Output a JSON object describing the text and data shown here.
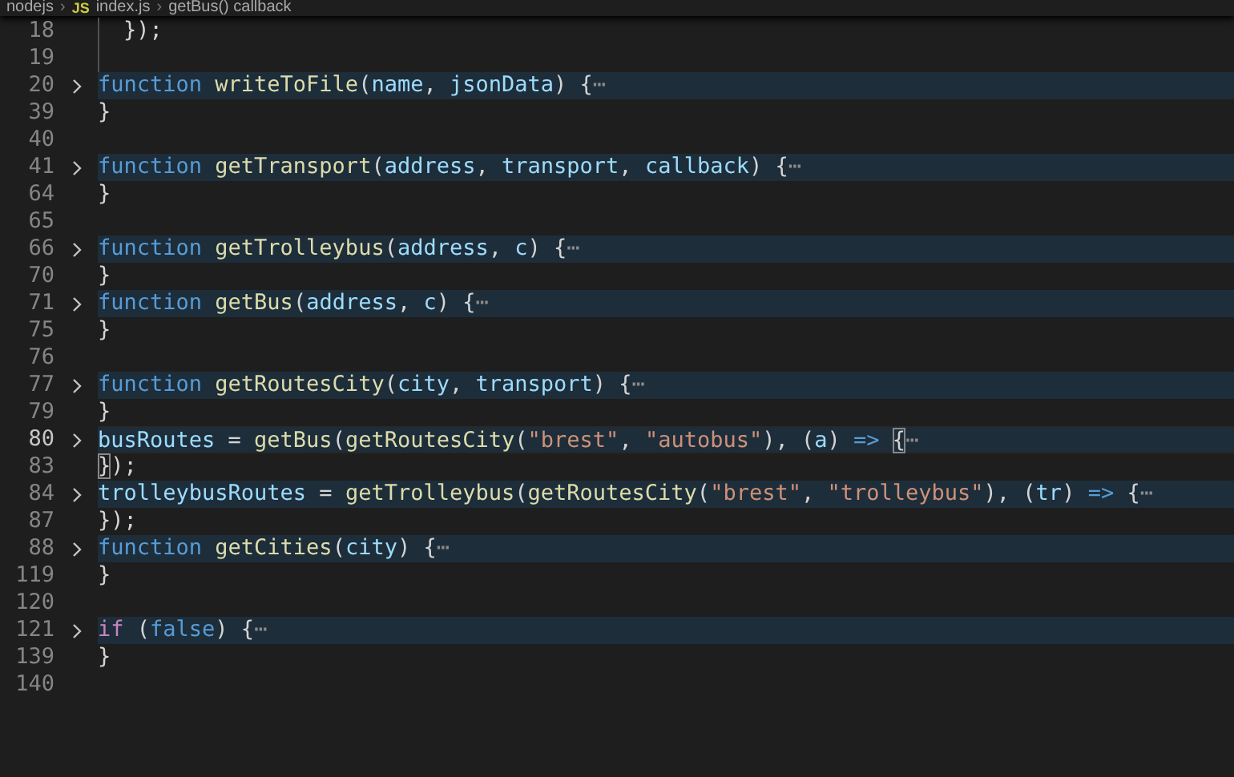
{
  "breadcrumb": [
    {
      "kind": "item",
      "text": "nodejs"
    },
    {
      "kind": "separator",
      "text": "›"
    },
    {
      "kind": "file-type",
      "text": "JS"
    },
    {
      "kind": "item",
      "text": "index.js"
    },
    {
      "kind": "separator",
      "text": "›"
    },
    {
      "kind": "item",
      "text": "getBus() callback"
    }
  ],
  "lines": [
    {
      "number": "18",
      "folded": false,
      "current": false,
      "indent": true,
      "tokens": [
        {
          "kind": "plain",
          "text": "});"
        }
      ]
    },
    {
      "number": "19",
      "current": false,
      "indent": true
    },
    {
      "number": "20",
      "folded": true,
      "current": false,
      "tokens": [
        {
          "kind": "keyword",
          "text": "function"
        },
        {
          "kind": "fn",
          "text": " writeToFile"
        },
        {
          "kind": "plain",
          "text": "("
        },
        {
          "kind": "param",
          "text": "name"
        },
        {
          "kind": "plain",
          "text": ", "
        },
        {
          "kind": "param",
          "text": "jsonData"
        },
        {
          "kind": "plain",
          "text": ") {"
        },
        {
          "kind": "fold",
          "text": "⋯"
        }
      ]
    },
    {
      "number": "39",
      "folded": false,
      "current": false,
      "tokens": [
        {
          "kind": "plain",
          "text": "}"
        }
      ]
    },
    {
      "number": "40",
      "current": false
    },
    {
      "number": "41",
      "folded": true,
      "current": false,
      "tokens": [
        {
          "kind": "keyword",
          "text": "function"
        },
        {
          "kind": "fn",
          "text": " getTransport"
        },
        {
          "kind": "plain",
          "text": "("
        },
        {
          "kind": "param",
          "text": "address"
        },
        {
          "kind": "plain",
          "text": ", "
        },
        {
          "kind": "param",
          "text": "transport"
        },
        {
          "kind": "plain",
          "text": ", "
        },
        {
          "kind": "param",
          "text": "callback"
        },
        {
          "kind": "plain",
          "text": ") {"
        },
        {
          "kind": "fold",
          "text": "⋯"
        }
      ]
    },
    {
      "number": "64",
      "folded": false,
      "current": false,
      "tokens": [
        {
          "kind": "plain",
          "text": "}"
        }
      ]
    },
    {
      "number": "65",
      "current": false
    },
    {
      "number": "66",
      "folded": true,
      "current": false,
      "tokens": [
        {
          "kind": "keyword",
          "text": "function"
        },
        {
          "kind": "fn",
          "text": " getTrolleybus"
        },
        {
          "kind": "plain",
          "text": "("
        },
        {
          "kind": "param",
          "text": "address"
        },
        {
          "kind": "plain",
          "text": ", "
        },
        {
          "kind": "param",
          "text": "c"
        },
        {
          "kind": "plain",
          "text": ") {"
        },
        {
          "kind": "fold",
          "text": "⋯"
        }
      ]
    },
    {
      "number": "70",
      "folded": false,
      "current": false,
      "tokens": [
        {
          "kind": "plain",
          "text": "}"
        }
      ]
    },
    {
      "number": "71",
      "folded": true,
      "current": false,
      "tokens": [
        {
          "kind": "keyword",
          "text": "function"
        },
        {
          "kind": "fn",
          "text": " getBus"
        },
        {
          "kind": "plain",
          "text": "("
        },
        {
          "kind": "param",
          "text": "address"
        },
        {
          "kind": "plain",
          "text": ", "
        },
        {
          "kind": "param",
          "text": "c"
        },
        {
          "kind": "plain",
          "text": ") {"
        },
        {
          "kind": "fold",
          "text": "⋯"
        }
      ]
    },
    {
      "number": "75",
      "folded": false,
      "current": false,
      "tokens": [
        {
          "kind": "plain",
          "text": "}"
        }
      ]
    },
    {
      "number": "76",
      "current": false
    },
    {
      "number": "77",
      "folded": true,
      "current": false,
      "tokens": [
        {
          "kind": "keyword",
          "text": "function"
        },
        {
          "kind": "fn",
          "text": " getRoutesCity"
        },
        {
          "kind": "plain",
          "text": "("
        },
        {
          "kind": "param",
          "text": "city"
        },
        {
          "kind": "plain",
          "text": ", "
        },
        {
          "kind": "param",
          "text": "transport"
        },
        {
          "kind": "plain",
          "text": ") {"
        },
        {
          "kind": "fold",
          "text": "⋯"
        }
      ]
    },
    {
      "number": "79",
      "folded": false,
      "current": false,
      "tokens": [
        {
          "kind": "plain",
          "text": "}"
        }
      ]
    },
    {
      "number": "80",
      "folded": true,
      "current": true,
      "tokens": [
        {
          "kind": "param",
          "text": "busRoutes"
        },
        {
          "kind": "plain",
          "text": " = "
        },
        {
          "kind": "fn",
          "text": "getBus"
        },
        {
          "kind": "plain",
          "text": "("
        },
        {
          "kind": "fn",
          "text": "getRoutesCity"
        },
        {
          "kind": "plain",
          "text": "("
        },
        {
          "kind": "string",
          "text": "\"brest\""
        },
        {
          "kind": "plain",
          "text": ", "
        },
        {
          "kind": "string",
          "text": "\"autobus\""
        },
        {
          "kind": "plain",
          "text": "), ("
        },
        {
          "kind": "param",
          "text": "a"
        },
        {
          "kind": "plain",
          "text": ") "
        },
        {
          "kind": "keyword",
          "text": "=> "
        },
        {
          "kind": "bracket",
          "text": "{"
        },
        {
          "kind": "fold",
          "text": "⋯"
        }
      ]
    },
    {
      "number": "83",
      "folded": false,
      "current": false,
      "tokens": [
        {
          "kind": "bracket",
          "text": "}"
        },
        {
          "kind": "plain",
          "text": ");"
        }
      ]
    },
    {
      "number": "84",
      "folded": true,
      "current": false,
      "tokens": [
        {
          "kind": "param",
          "text": "trolleybusRoutes"
        },
        {
          "kind": "plain",
          "text": " = "
        },
        {
          "kind": "fn",
          "text": "getTrolleybus"
        },
        {
          "kind": "plain",
          "text": "("
        },
        {
          "kind": "fn",
          "text": "getRoutesCity"
        },
        {
          "kind": "plain",
          "text": "("
        },
        {
          "kind": "string",
          "text": "\"brest\""
        },
        {
          "kind": "plain",
          "text": ", "
        },
        {
          "kind": "string",
          "text": "\"trolleybus\""
        },
        {
          "kind": "plain",
          "text": "), ("
        },
        {
          "kind": "param",
          "text": "tr"
        },
        {
          "kind": "plain",
          "text": ") "
        },
        {
          "kind": "keyword",
          "text": "=>"
        },
        {
          "kind": "plain",
          "text": " {"
        },
        {
          "kind": "fold",
          "text": "⋯"
        }
      ]
    },
    {
      "number": "87",
      "folded": false,
      "current": false,
      "tokens": [
        {
          "kind": "plain",
          "text": "});"
        }
      ]
    },
    {
      "number": "88",
      "folded": true,
      "current": false,
      "tokens": [
        {
          "kind": "keyword",
          "text": "function"
        },
        {
          "kind": "fn",
          "text": " getCities"
        },
        {
          "kind": "plain",
          "text": "("
        },
        {
          "kind": "param",
          "text": "city"
        },
        {
          "kind": "plain",
          "text": ") {"
        },
        {
          "kind": "fold",
          "text": "⋯"
        }
      ]
    },
    {
      "number": "119",
      "folded": false,
      "current": false,
      "tokens": [
        {
          "kind": "plain",
          "text": "}"
        }
      ]
    },
    {
      "number": "120",
      "current": false
    },
    {
      "number": "121",
      "folded": true,
      "current": false,
      "tokens": [
        {
          "kind": "control",
          "text": "if"
        },
        {
          "kind": "plain",
          "text": " ("
        },
        {
          "kind": "keyword",
          "text": "false"
        },
        {
          "kind": "plain",
          "text": ") {"
        },
        {
          "kind": "fold",
          "text": "⋯"
        }
      ]
    },
    {
      "number": "139",
      "folded": false,
      "current": false,
      "tokens": [
        {
          "kind": "plain",
          "text": "}"
        }
      ]
    },
    {
      "number": "140",
      "current": false
    }
  ]
}
